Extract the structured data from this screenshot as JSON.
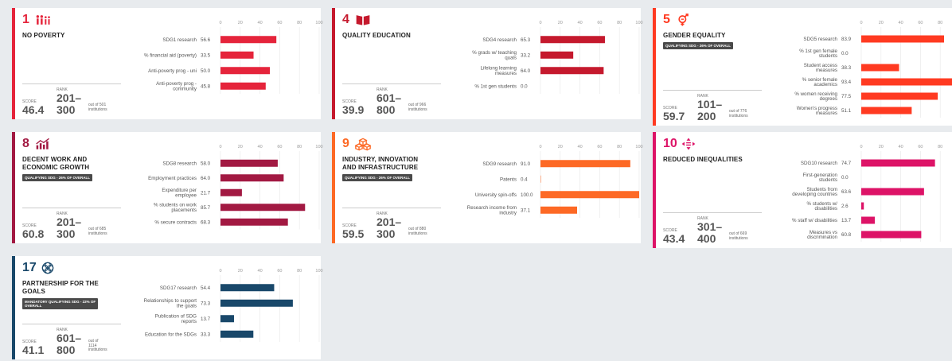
{
  "cards": [
    {
      "id": "sdg1",
      "number": "1",
      "title": "NO POVERTY",
      "badge": "",
      "color": "#e5243b",
      "icon": "people-icon",
      "score_label": "SCORE",
      "score": "46.4",
      "rank_label": "RANK",
      "rank": "201–\n300",
      "out_of": "out of 501\ninstitutions",
      "chart_data": {
        "type": "bar",
        "ticks": [
          "0",
          "20",
          "40",
          "60",
          "80",
          "100"
        ],
        "xlim": [
          0,
          100
        ],
        "categories": [
          "SDG1 research",
          "% financial aid (poverty)",
          "Anti-poverty prog - uni",
          "Anti-poverty prog -\ncommunity"
        ],
        "values": [
          56.6,
          33.5,
          50.0,
          45.8
        ],
        "value_labels": [
          "56.6",
          "33.5",
          "50.0",
          "45.8"
        ]
      }
    },
    {
      "id": "sdg4",
      "number": "4",
      "title": "QUALITY EDUCATION",
      "badge": "",
      "color": "#c5192d",
      "icon": "book-icon",
      "score_label": "SCORE",
      "score": "39.9",
      "rank_label": "RANK",
      "rank": "601–\n800",
      "out_of": "out of 966\ninstitutions",
      "chart_data": {
        "type": "bar",
        "ticks": [
          "0",
          "20",
          "40",
          "60",
          "80",
          "100"
        ],
        "xlim": [
          0,
          100
        ],
        "categories": [
          "SDG4 research",
          "% grads w/ teaching\nquals",
          "Lifelong learning\nmeasures",
          "% 1st gen students"
        ],
        "values": [
          65.3,
          33.2,
          64.0,
          0.0
        ],
        "value_labels": [
          "65.3",
          "33.2",
          "64.0",
          "0.0"
        ]
      }
    },
    {
      "id": "sdg5",
      "number": "5",
      "title": "GENDER EQUALITY",
      "badge": "QUALIFYING SDG - 26% OF OVERALL",
      "color": "#ff3a21",
      "icon": "gender-icon",
      "score_label": "SCORE",
      "score": "59.7",
      "rank_label": "RANK",
      "rank": "101–\n200",
      "out_of": "out of 776\ninstitutions",
      "chart_data": {
        "type": "bar",
        "ticks": [
          "0",
          "20",
          "40",
          "60",
          "80",
          "100"
        ],
        "xlim": [
          0,
          100
        ],
        "categories": [
          "SDG5 research",
          "% 1st gen female\nstudents",
          "Student access\nmeasures",
          "% senior female\nacademics",
          "% women receiving\ndegrees",
          "Women's progress\nmeasures"
        ],
        "values": [
          83.9,
          0.0,
          38.3,
          93.4,
          77.5,
          51.1
        ],
        "value_labels": [
          "83.9",
          "0.0",
          "38.3",
          "93.4",
          "77.5",
          "51.1"
        ]
      }
    },
    {
      "id": "sdg8",
      "number": "8",
      "title": "DECENT WORK AND\nECONOMIC GROWTH",
      "badge": "QUALIFYING SDG - 26% OF OVERALL",
      "color": "#a21942",
      "icon": "growth-chart-icon",
      "score_label": "SCORE",
      "score": "60.8",
      "rank_label": "RANK",
      "rank": "201–\n300",
      "out_of": "out of 685\ninstitutions",
      "chart_data": {
        "type": "bar",
        "ticks": [
          "0",
          "20",
          "40",
          "60",
          "80",
          "100"
        ],
        "xlim": [
          0,
          100
        ],
        "categories": [
          "SDG8 research",
          "Employment practices",
          "Expenditure per\nemployee",
          "% students on work\nplacements",
          "% secure contracts"
        ],
        "values": [
          58.0,
          64.0,
          21.7,
          85.7,
          68.3
        ],
        "value_labels": [
          "58.0",
          "64.0",
          "21.7",
          "85.7",
          "68.3"
        ]
      }
    },
    {
      "id": "sdg9",
      "number": "9",
      "title": "INDUSTRY, INNOVATION\nAND INFRASTRUCTURE",
      "badge": "QUALIFYING SDG - 26% OF OVERALL",
      "color": "#fd6925",
      "icon": "cubes-icon",
      "score_label": "SCORE",
      "score": "59.5",
      "rank_label": "RANK",
      "rank": "201–\n300",
      "out_of": "out of 880\ninstitutions",
      "chart_data": {
        "type": "bar",
        "ticks": [
          "0",
          "20",
          "40",
          "60",
          "80",
          "100"
        ],
        "xlim": [
          0,
          100
        ],
        "categories": [
          "SDG9 research",
          "Patents",
          "University spin-offs",
          "Research income from\nindustry"
        ],
        "values": [
          91.0,
          0.4,
          100.0,
          37.1
        ],
        "value_labels": [
          "91.0",
          "0.4",
          "100.0",
          "37.1"
        ]
      }
    },
    {
      "id": "sdg10",
      "number": "10",
      "title": "REDUCED INEQUALITIES",
      "badge": "",
      "color": "#dd1367",
      "icon": "arrows-icon",
      "score_label": "SCORE",
      "score": "43.4",
      "rank_label": "RANK",
      "rank": "301–\n400",
      "out_of": "out of 669\ninstitutions",
      "chart_data": {
        "type": "bar",
        "ticks": [
          "0",
          "20",
          "40",
          "60",
          "80",
          "100"
        ],
        "xlim": [
          0,
          100
        ],
        "categories": [
          "SDG10 research",
          "First-generation\nstudents",
          "Students from\ndeveloping countries",
          "% students w/\ndisabilities",
          "% staff w/ disabilities",
          "Measures vs\ndiscrimination"
        ],
        "values": [
          74.7,
          0.0,
          63.6,
          2.6,
          13.7,
          60.8
        ],
        "value_labels": [
          "74.7",
          "0.0",
          "63.6",
          "2.6",
          "13.7",
          "60.8"
        ]
      }
    },
    {
      "id": "sdg17",
      "number": "17",
      "title": "PARTNERSHIP FOR THE\nGOALS",
      "badge": "MANDATORY QUALIFYING SDG - 22% OF\nOVERALL",
      "color": "#19486a",
      "icon": "partnership-icon",
      "score_label": "SCORE",
      "score": "41.1",
      "rank_label": "RANK",
      "rank": "601–\n800",
      "out_of": "out of\n1114\ninstitutions",
      "chart_data": {
        "type": "bar",
        "ticks": [
          "0",
          "20",
          "40",
          "60",
          "80",
          "100"
        ],
        "xlim": [
          0,
          100
        ],
        "categories": [
          "SDG17 research",
          "Relationships to support\nthe goals",
          "Publication of SDG\nreports",
          "Education for the SDGs"
        ],
        "values": [
          54.4,
          73.3,
          13.7,
          33.3
        ],
        "value_labels": [
          "54.4",
          "73.3",
          "13.7",
          "33.3"
        ]
      }
    }
  ]
}
